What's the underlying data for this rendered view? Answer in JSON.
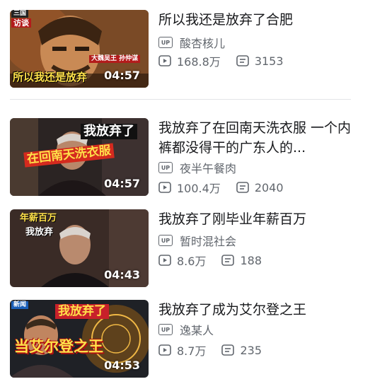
{
  "videos": [
    {
      "title": "所以我还是放弃了合肥",
      "uploader": "酸杏核儿",
      "views": "168.8万",
      "danmaku": "3153",
      "duration": "04:57",
      "thumb_text": [
        "所以我还是放弃",
        "大魏吴王 孙仲谋",
        "三国",
        "访谈"
      ]
    },
    {
      "title": "我放弃了在回南天洗衣服 一个内裤都没得干的广东人的...",
      "uploader": "夜半午餐肉",
      "views": "100.4万",
      "danmaku": "2040",
      "duration": "04:57",
      "thumb_text": [
        "我放弃了",
        "在回南天洗衣服"
      ]
    },
    {
      "title": "我放弃了刚毕业年薪百万",
      "uploader": "暂时混社会",
      "views": "8.6万",
      "danmaku": "188",
      "duration": "04:43",
      "thumb_text": [
        "年薪百万",
        "我放弃"
      ]
    },
    {
      "title": "我放弃了成为艾尔登之王",
      "uploader": "逸某人",
      "views": "8.7万",
      "danmaku": "235",
      "duration": "04:53",
      "thumb_text": [
        "我放弃了",
        "当艾尔登之王",
        "新闻"
      ]
    }
  ],
  "badges": {
    "up": "UP"
  },
  "icons": {
    "views": "play-count-icon",
    "danmaku": "danmaku-icon"
  },
  "colors": {
    "text": "#18191c",
    "meta": "#61666d",
    "divider": "#e3e5e7"
  }
}
